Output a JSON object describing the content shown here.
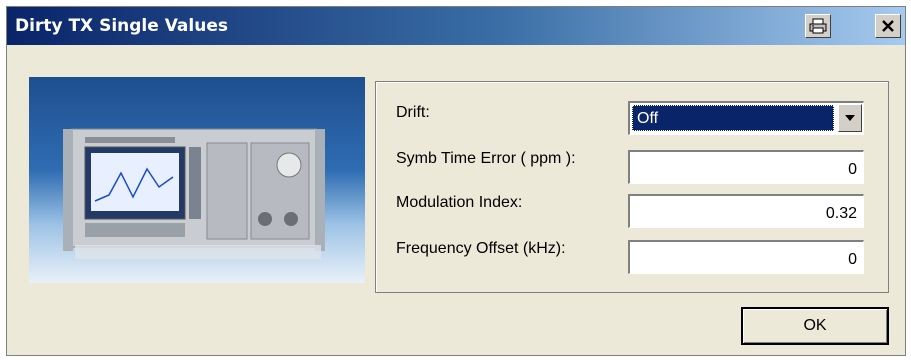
{
  "window": {
    "title": "Dirty TX Single Values"
  },
  "form": {
    "drift": {
      "label": "Drift:",
      "value": "Off"
    },
    "symb_time_error": {
      "label": "Symb Time Error ( ppm ):",
      "value": "0"
    },
    "modulation_index": {
      "label": "Modulation Index:",
      "value": "0.32"
    },
    "frequency_offset": {
      "label": "Frequency Offset (kHz):",
      "value": "0"
    }
  },
  "buttons": {
    "ok": "OK"
  },
  "icons": {
    "print": "print-icon",
    "close": "close-icon",
    "dropdown": "chevron-down-icon"
  }
}
